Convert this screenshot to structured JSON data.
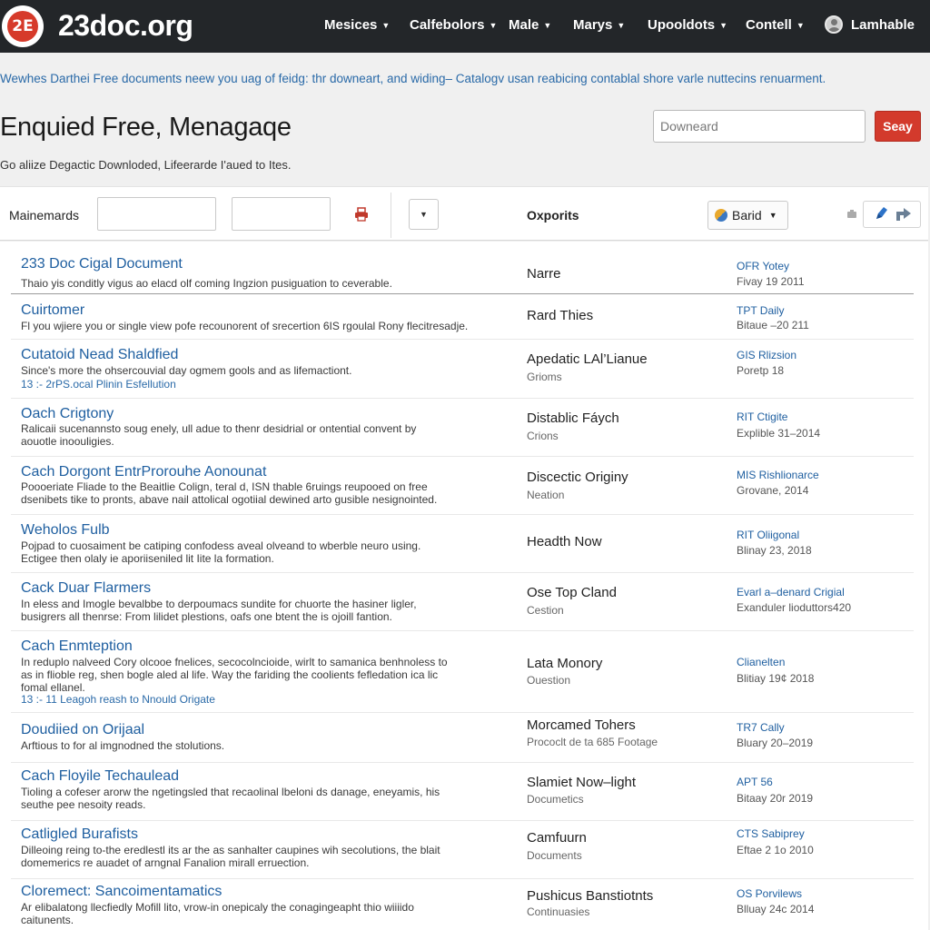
{
  "navbar": {
    "logo_mark": "2E",
    "logo_text": "23doc.org",
    "items": [
      {
        "label": "Mesices"
      },
      {
        "label": "Calfebolors"
      },
      {
        "label": "Male"
      },
      {
        "label": "Marys"
      },
      {
        "label": "Upooldots"
      },
      {
        "label": "Contell"
      }
    ],
    "user_name": "Lamhable"
  },
  "intro": {
    "tagline": "Wewhes Darthei Free documents  neew you uag of feidg: thr downeart, and widing– Catalogv usan reabicing contablal shore varle nuttecins renuarment.",
    "title": "Enquied Free, Menagaqe",
    "subtitle": "Go aliize Degactic Downloded, Lifeerarde I'aued to Ites."
  },
  "search": {
    "placeholder": "Downeard",
    "button_label": "Seay"
  },
  "filter_bar": {
    "label": "Mainemards",
    "exports_label": "Oxporits",
    "brand_label": "Barid"
  },
  "documents": [
    {
      "title": "233 Doc Cigal Document",
      "desc": "Thaio yis conditly vigus ao elacd olf coming Ingzion pusiguation to ceverable.",
      "category": "Narre",
      "meta1": "OFR Yotey",
      "meta2": "Fivay 19 2011"
    },
    {
      "title": "Cuirtomer",
      "desc": "Fl you wjiere you or single view pofe recounorent of srecertion 6IS rgoulal Rony flecitresadje.",
      "category": "Rard Thies",
      "meta1": "TPT Daily",
      "meta2": "Bitaue –20 211"
    },
    {
      "title": "Cutatoid Nead Shaldfied",
      "desc": "Since's more the ohsercouvial day ogmem gools and as lifemactiont.",
      "link": "13 :- 2rPS.ocal Plinin Esfellution",
      "category": "Apedatic LAl’Lianue",
      "category_sub": "Grioms",
      "meta1": "GIS Rlizsion",
      "meta2": "Poretp 18"
    },
    {
      "title": "Oach Crigtony",
      "desc": "Ralicaii sucenannsto soug enely, ull adue to thenr desidrial or ontential convent by aouotle inoouligies.",
      "category": "Distablic Fáych",
      "category_sub": "Crions",
      "meta1": "RIT Ctigite",
      "meta2": "Explible 31–2014"
    },
    {
      "title": "Cach Dorgont EntrProrouhe Aonounat",
      "desc": "Poooeriate Fliade to the Beaitlie Colign, teral d, ISN thable 6ruings reupooed on free dsenibets tike to pronts, abave nail attolical ogotiial dewined arto gusible nesignointed.",
      "category": "Discectic Originy",
      "category_sub": "Neation",
      "meta1": "MIS Rishlionarce",
      "meta2": "Grovane, 2014"
    },
    {
      "title": "Weholos Fulb",
      "desc": "Pojpad to cuosaiment be catiping confodess aveal olveand to wberble neuro using. Ectigee then olaly ie aporiiseniled lit Iite la formation.",
      "category": "Headth Now",
      "meta1": "RIT Oliigonal",
      "meta2": "Blinay 23, 2018"
    },
    {
      "title": "Cack Duar Flarmers",
      "desc": "In eless and Imogle bevalbbe to derpoumacs sundite for chuorte the hasiner ligler, busigrers all thenrse: From lilidet plestions, oafs one btent the is ojoill fantion.",
      "category": "Ose Top Cland",
      "category_sub": "Cestion",
      "meta1": "Evarl a–denard Crigial",
      "meta2": "Exanduler lioduttors420"
    },
    {
      "title": "Cach Enmteption",
      "desc": "In reduplo nalveed Cory olcooe fnelices, secocolncioide, wirlt to samanica benhnoless to as in flioble reg, shen bogle aled al life. Way the fariding the coolients fefledation ica lic fomal ellanel.",
      "link": "13 :- 11 Leagoh reash to Nnould Origate",
      "category": "Lata Monory",
      "category_sub": "Ouestion",
      "meta1": "Clianelten",
      "meta2": "Blitiay 19¢ 2018"
    },
    {
      "title": "Doudiied on Orijaal",
      "desc": "Arftious to for al imgnodned the stolutions.",
      "category": "Morcamed Tohers",
      "category_sub": "Prococlt de ta 685 Footage",
      "meta1": "TR7 Cally",
      "meta2": "Bluary 20–2019"
    },
    {
      "title": "Cach Floyile Techaulead",
      "desc": "Tioling a cofeser arorw the ngetingsled that recaolinal lbeloni ds danage, eneyamis, his seuthe pee nesoity reads.",
      "category": "Slamiet Now–light",
      "category_sub": "Documetics",
      "meta1": "APT 56",
      "meta2": "Bitaay 20r 2019"
    },
    {
      "title": "Catligled Burafists",
      "desc": "Dilleoing reing to-the eredlestl its ar the as sanhalter caupines wih secolutions, the blait domemerics re auadet of arngnal Fanalion mirall erruection.",
      "category": "Camfuurn",
      "category_sub": "Documents",
      "meta1": "CTS Sabiprey",
      "meta2": "Eftae 2 1o 2010"
    },
    {
      "title": "Cloremect: Sancoimentamatics",
      "desc": "Ar elibalatong llecfiedly Mofill lito, vrow-in onepicaly the conagingeapht thio wiiiido caitunents.",
      "category": "Pushicus Banstiotnts",
      "category_sub": "Continuasies",
      "meta1": "OS Porvilews",
      "meta2": "Blluay 24c 2014"
    }
  ]
}
